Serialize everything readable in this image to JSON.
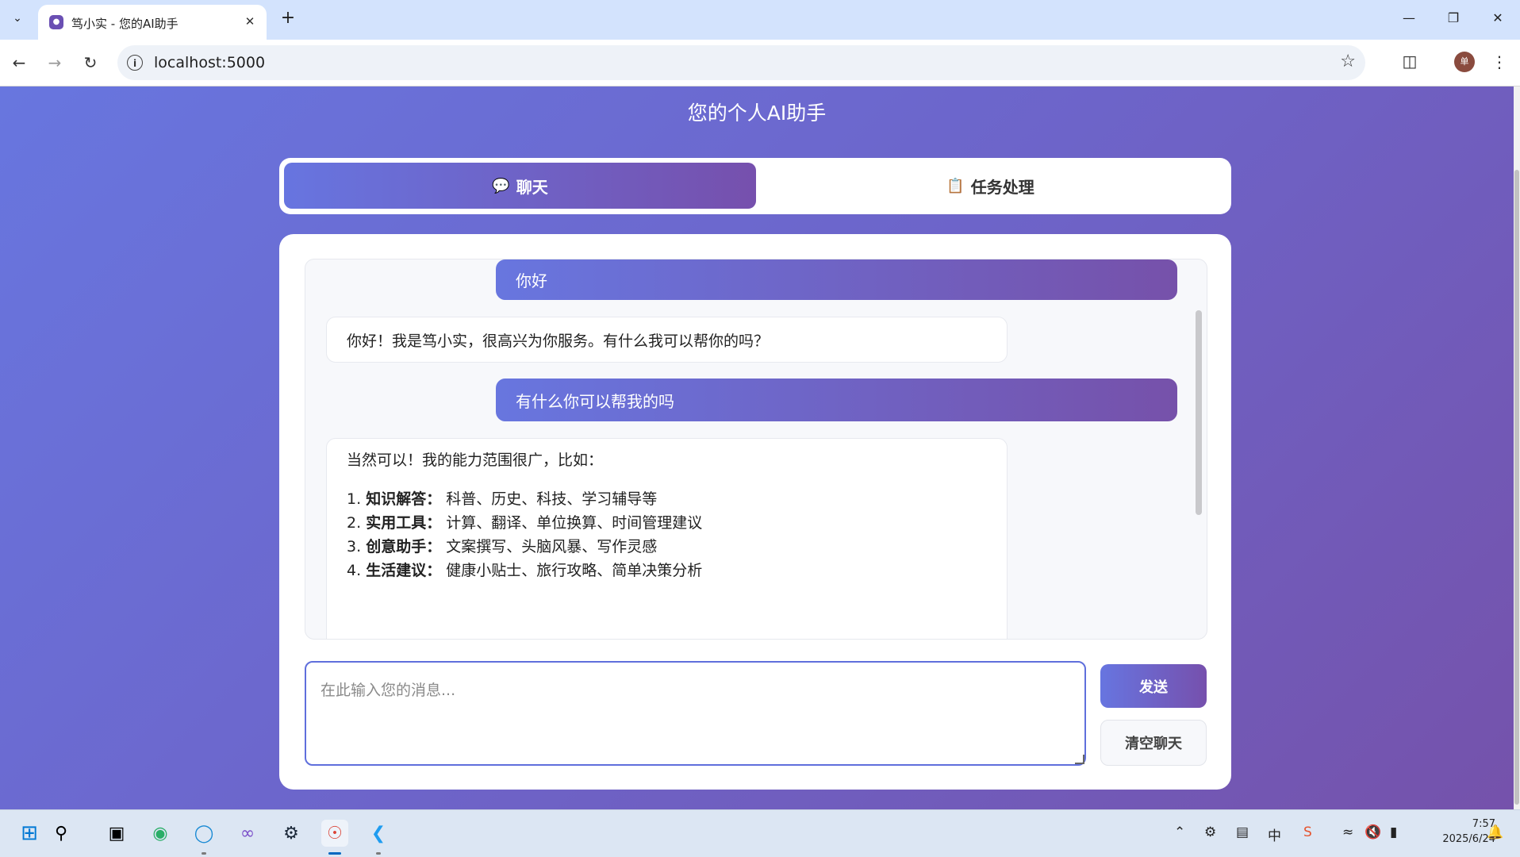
{
  "browser": {
    "tab_title": "笃小实 - 您的AI助手",
    "url": "localhost:5000",
    "avatar_letter": "单"
  },
  "page": {
    "subtitle": "您的个人AI助手",
    "tabs": [
      {
        "label": "聊天",
        "icon": "speech-bubble-icon",
        "active": true
      },
      {
        "label": "任务处理",
        "icon": "clipboard-icon",
        "active": false
      }
    ]
  },
  "chat": {
    "messages": [
      {
        "role": "user",
        "text": "你好"
      },
      {
        "role": "assistant",
        "text": "你好！我是笃小实，很高兴为你服务。有什么我可以帮你的吗？"
      },
      {
        "role": "user",
        "text": "有什么你可以帮我的吗"
      },
      {
        "role": "assistant",
        "intro": "当然可以！我的能力范围很广，比如：",
        "items": [
          {
            "num": "1.",
            "title": "知识解答",
            "sep": "：",
            "desc": "科普、历史、科技、学习辅导等"
          },
          {
            "num": "2.",
            "title": "实用工具",
            "sep": "：",
            "desc": "计算、翻译、单位换算、时间管理建议"
          },
          {
            "num": "3.",
            "title": "创意助手",
            "sep": "：",
            "desc": "文案撰写、头脑风暴、写作灵感"
          },
          {
            "num": "4.",
            "title": "生活建议",
            "sep": "：",
            "desc": "健康小贴士、旅行攻略、简单决策分析"
          }
        ]
      }
    ],
    "input_placeholder": "在此输入您的消息...",
    "input_value": "",
    "send_label": "发送",
    "clear_label": "清空聊天"
  },
  "taskbar": {
    "time": "7:57",
    "date": "2025/6/24"
  },
  "colors": {
    "gradient_start": "#6876df",
    "gradient_end": "#7552ab",
    "accent": "#5f6fdc"
  }
}
